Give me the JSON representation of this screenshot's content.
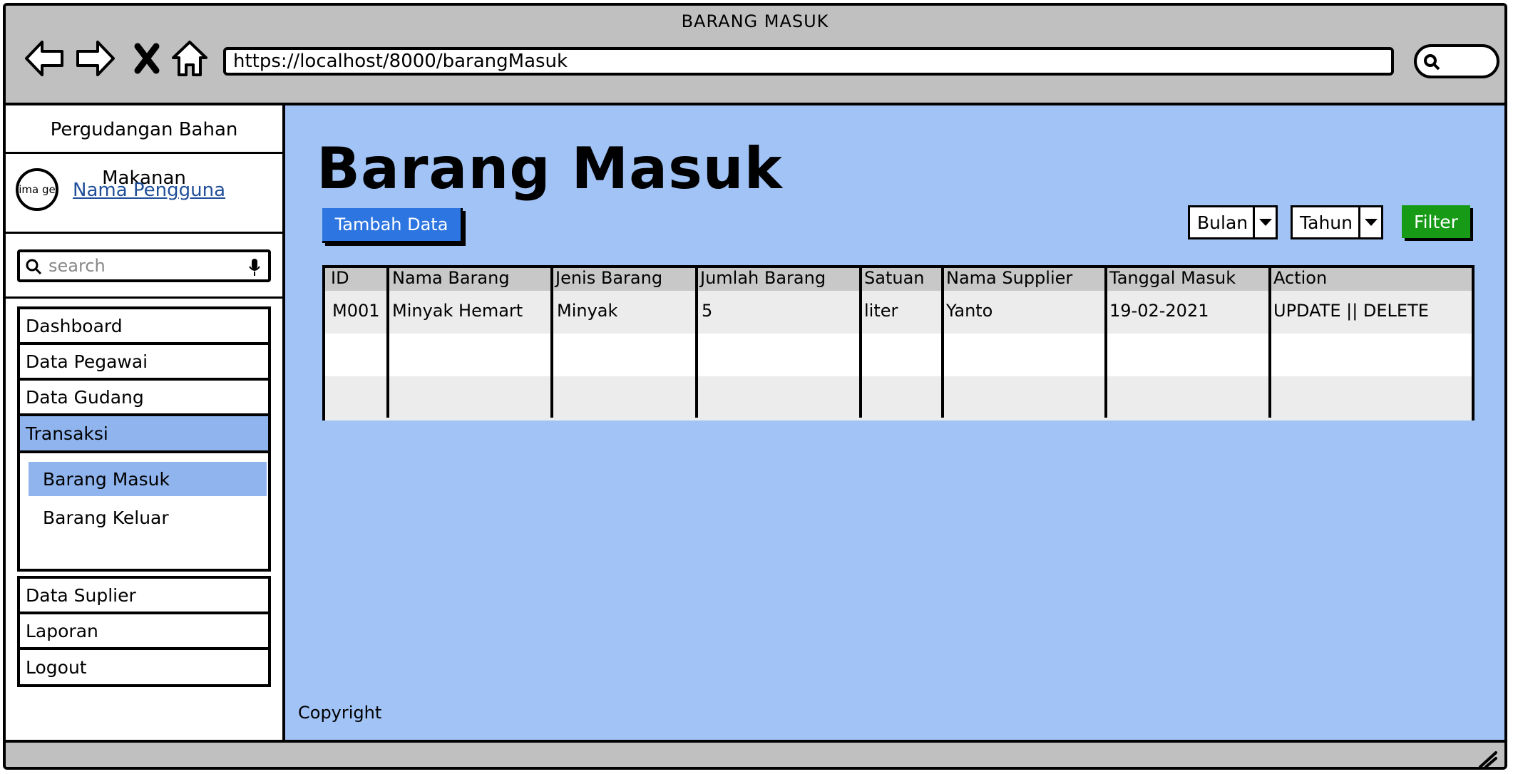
{
  "window": {
    "title": "BARANG MASUK",
    "url": "https://localhost/8000/barangMasuk"
  },
  "sidebar": {
    "brand": "Pergudangan Bahan Makanan",
    "avatar_text": "ima ge",
    "username": "Nama Pengguna",
    "search_placeholder": "search",
    "items": [
      {
        "label": "Dashboard"
      },
      {
        "label": "Data Pegawai"
      },
      {
        "label": "Data Gudang"
      },
      {
        "label": "Transaksi"
      },
      {
        "label": "Data Suplier"
      },
      {
        "label": "Laporan"
      },
      {
        "label": "Logout"
      }
    ],
    "subitems": [
      {
        "label": "Barang Masuk"
      },
      {
        "label": "Barang Keluar"
      }
    ]
  },
  "main": {
    "title": "Barang Masuk",
    "add_button": "Tambah Data",
    "month_select": "Bulan",
    "year_select": "Tahun",
    "filter_button": "Filter",
    "table": {
      "headers": [
        "ID",
        "Nama Barang",
        "Jenis Barang",
        "Jumlah Barang",
        "Satuan",
        "Nama Supplier",
        "Tanggal Masuk",
        "Action"
      ],
      "rows": [
        [
          "M001",
          "Minyak Hemart",
          "Minyak",
          "5",
          "liter",
          "Yanto",
          "19-02-2021",
          "UPDATE || DELETE"
        ]
      ]
    },
    "copyright": "Copyright"
  },
  "colors": {
    "content_bg": "#a1c3f6",
    "active_menu": "#8fb4ee",
    "add_button": "#2d75e0",
    "filter_button": "#179b17",
    "link": "#1f4e99"
  },
  "icons": [
    "back-arrow-icon",
    "forward-arrow-icon",
    "close-icon",
    "home-icon",
    "search-icon",
    "microphone-icon",
    "resize-grip-icon"
  ]
}
